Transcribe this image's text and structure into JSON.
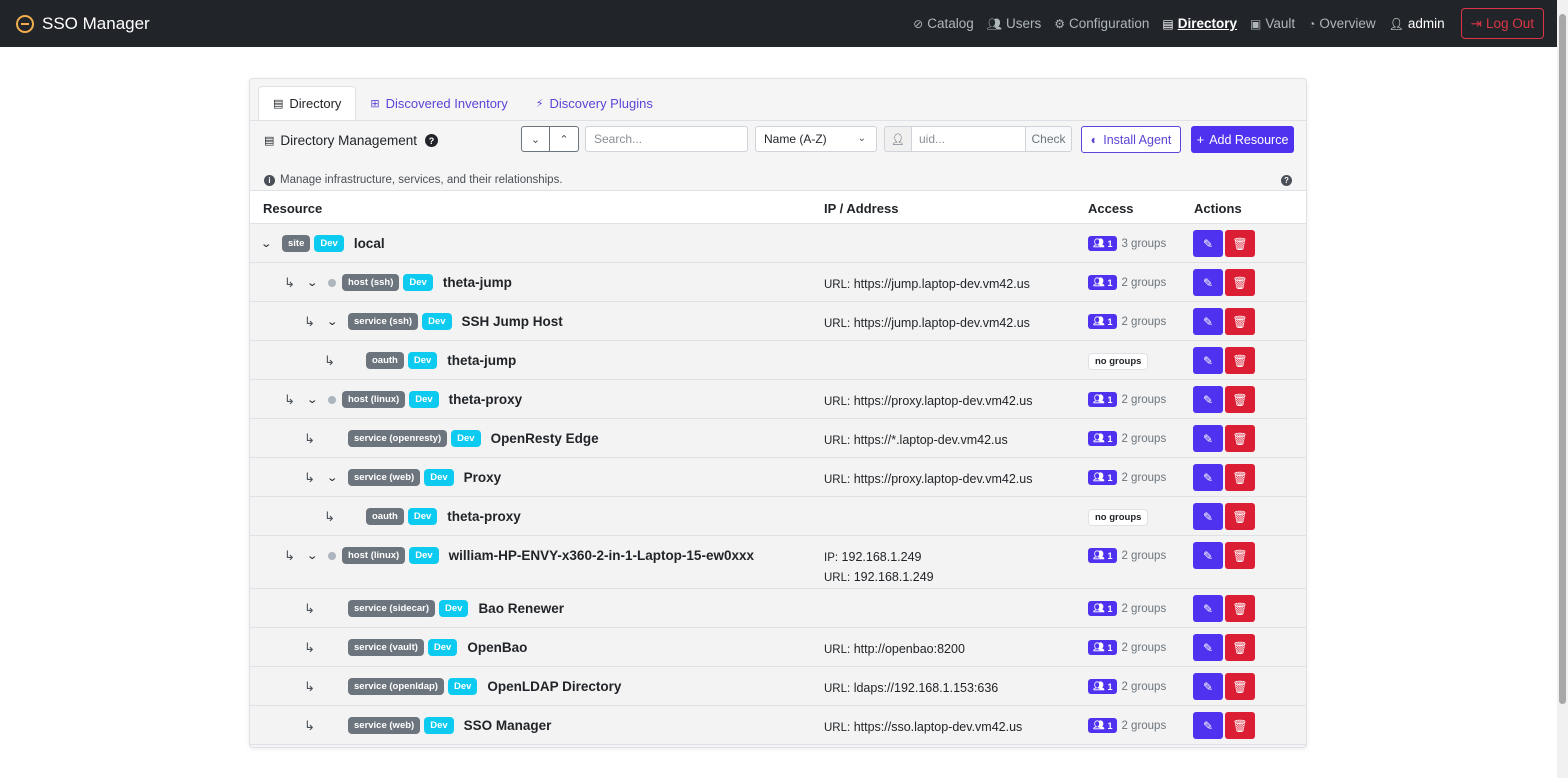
{
  "navbar": {
    "brand": "SSO Manager",
    "links": {
      "catalog": "Catalog",
      "users": "Users",
      "configuration": "Configuration",
      "directory": "Directory",
      "vault": "Vault",
      "overview": "Overview"
    },
    "user": "admin",
    "logout": "Log Out"
  },
  "tabs": {
    "directory": "Directory",
    "inventory": "Discovered Inventory",
    "plugins": "Discovery Plugins"
  },
  "toolbar": {
    "title": "Directory Management",
    "search_placeholder": "Search...",
    "sort_value": "Name (A-Z)",
    "uid_placeholder": "uid...",
    "check": "Check",
    "install_agent": "Install Agent",
    "add_resource": "Add Resource"
  },
  "description": "Manage infrastructure, services, and their relationships.",
  "table": {
    "headers": {
      "resource": "Resource",
      "ip": "IP / Address",
      "access": "Access",
      "actions": "Actions"
    },
    "rows": [
      {
        "type": "site",
        "env": "Dev",
        "name": "local",
        "addr": [],
        "members": "1",
        "groups": "3 groups"
      },
      {
        "type": "host (ssh)",
        "env": "Dev",
        "name": "theta-jump",
        "addr": [
          {
            "label": "URL:",
            "value": "https://jump.laptop-dev.vm42.us"
          }
        ],
        "members": "1",
        "groups": "2 groups"
      },
      {
        "type": "service (ssh)",
        "env": "Dev",
        "name": "SSH Jump Host",
        "addr": [
          {
            "label": "URL:",
            "value": "https://jump.laptop-dev.vm42.us"
          }
        ],
        "members": "1",
        "groups": "2 groups"
      },
      {
        "type": "oauth",
        "env": "Dev",
        "name": "theta-jump",
        "addr": [],
        "nogroups": "no groups"
      },
      {
        "type": "host (linux)",
        "env": "Dev",
        "name": "theta-proxy",
        "addr": [
          {
            "label": "URL:",
            "value": "https://proxy.laptop-dev.vm42.us"
          }
        ],
        "members": "1",
        "groups": "2 groups"
      },
      {
        "type": "service (openresty)",
        "env": "Dev",
        "name": "OpenResty Edge",
        "addr": [
          {
            "label": "URL:",
            "value": "https://*.laptop-dev.vm42.us"
          }
        ],
        "members": "1",
        "groups": "2 groups"
      },
      {
        "type": "service (web)",
        "env": "Dev",
        "name": "Proxy",
        "addr": [
          {
            "label": "URL:",
            "value": "https://proxy.laptop-dev.vm42.us"
          }
        ],
        "members": "1",
        "groups": "2 groups"
      },
      {
        "type": "oauth",
        "env": "Dev",
        "name": "theta-proxy",
        "addr": [],
        "nogroups": "no groups"
      },
      {
        "type": "host (linux)",
        "env": "Dev",
        "name": "william-HP-ENVY-x360-2-in-1-Laptop-15-ew0xxx",
        "addr": [
          {
            "label": "IP:",
            "value": "192.168.1.249"
          },
          {
            "label": "URL:",
            "value": "192.168.1.249"
          }
        ],
        "members": "1",
        "groups": "2 groups"
      },
      {
        "type": "service (sidecar)",
        "env": "Dev",
        "name": "Bao Renewer",
        "addr": [],
        "members": "1",
        "groups": "2 groups"
      },
      {
        "type": "service (vault)",
        "env": "Dev",
        "name": "OpenBao",
        "addr": [
          {
            "label": "URL:",
            "value": "http://openbao:8200"
          }
        ],
        "members": "1",
        "groups": "2 groups"
      },
      {
        "type": "service (openldap)",
        "env": "Dev",
        "name": "OpenLDAP Directory",
        "addr": [
          {
            "label": "URL:",
            "value": "ldaps://192.168.1.153:636"
          }
        ],
        "members": "1",
        "groups": "2 groups"
      },
      {
        "type": "service (web)",
        "env": "Dev",
        "name": "SSO Manager",
        "addr": [
          {
            "label": "URL:",
            "value": "https://sso.laptop-dev.vm42.us"
          }
        ],
        "members": "1",
        "groups": "2 groups"
      }
    ]
  }
}
